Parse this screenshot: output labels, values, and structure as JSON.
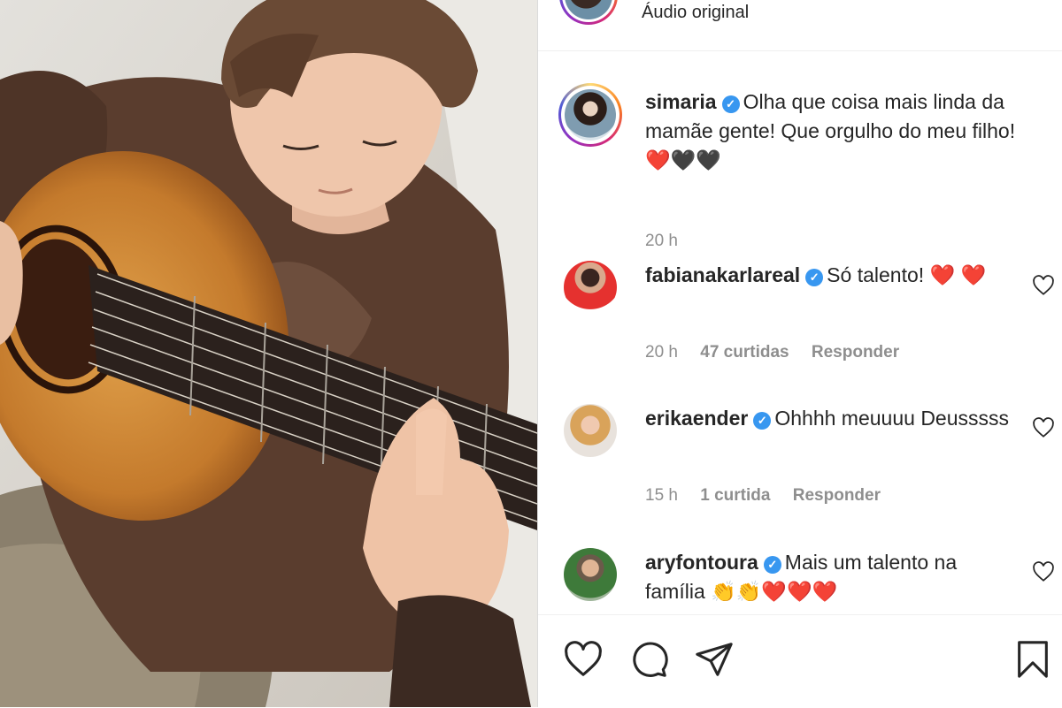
{
  "post": {
    "audio_label": "Áudio original"
  },
  "caption": {
    "username": "simaria",
    "text": "Olha que coisa mais linda da mamãe gente! Que orgulho do meu filho!",
    "emoji": "❤️🖤🖤",
    "time": "20 h"
  },
  "comments": [
    {
      "username": "fabianakarlareal",
      "text": "Só talento!",
      "emoji": "❤️ ❤️",
      "time": "20 h",
      "likes": "47 curtidas",
      "reply": "Responder"
    },
    {
      "username": "erikaender",
      "text": "Ohhhh meuuuu Deusssss",
      "time": "15 h",
      "likes": "1 curtida",
      "reply": "Responder"
    },
    {
      "username": "aryfontoura",
      "text": "Mais um talento na família",
      "emoji": "👏👏❤️❤️❤️"
    }
  ],
  "icons": {
    "like": "heart-icon",
    "comment": "comment-icon",
    "share": "paper-plane-icon",
    "save": "bookmark-icon",
    "verified": "verified-badge-icon"
  },
  "colors": {
    "verified": "#3897f0",
    "meta_text": "#8e8e8e",
    "heart": "#e0101b"
  }
}
